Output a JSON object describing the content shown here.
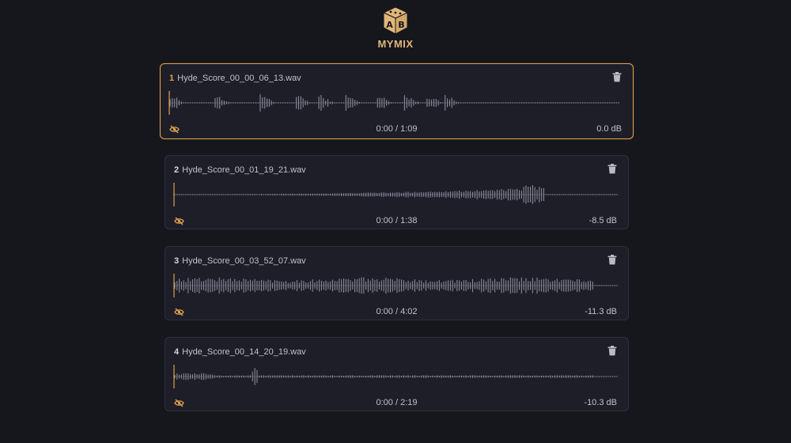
{
  "app": {
    "brand": "MYMIX",
    "logo_icon": "ab-dice-icon",
    "accent_color": "#e0a24a",
    "logo_color": "#e1b77a"
  },
  "tracks": [
    {
      "index": "1",
      "filename": "Hyde_Score_00_00_06_13.wav",
      "time": "0:00 / 1:09",
      "gain": "0.0 dB",
      "active": true,
      "playhead": 0.0
    },
    {
      "index": "2",
      "filename": "Hyde_Score_00_01_19_21.wav",
      "time": "0:00 / 1:38",
      "gain": "-8.5 dB",
      "active": false,
      "playhead": 0.0
    },
    {
      "index": "3",
      "filename": "Hyde_Score_00_03_52_07.wav",
      "time": "0:00 / 4:02",
      "gain": "-11.3 dB",
      "active": false,
      "playhead": 0.0
    },
    {
      "index": "4",
      "filename": "Hyde_Score_00_14_20_19.wav",
      "time": "0:00 / 2:19",
      "gain": "-10.3 dB",
      "active": false,
      "playhead": 0.0
    }
  ]
}
